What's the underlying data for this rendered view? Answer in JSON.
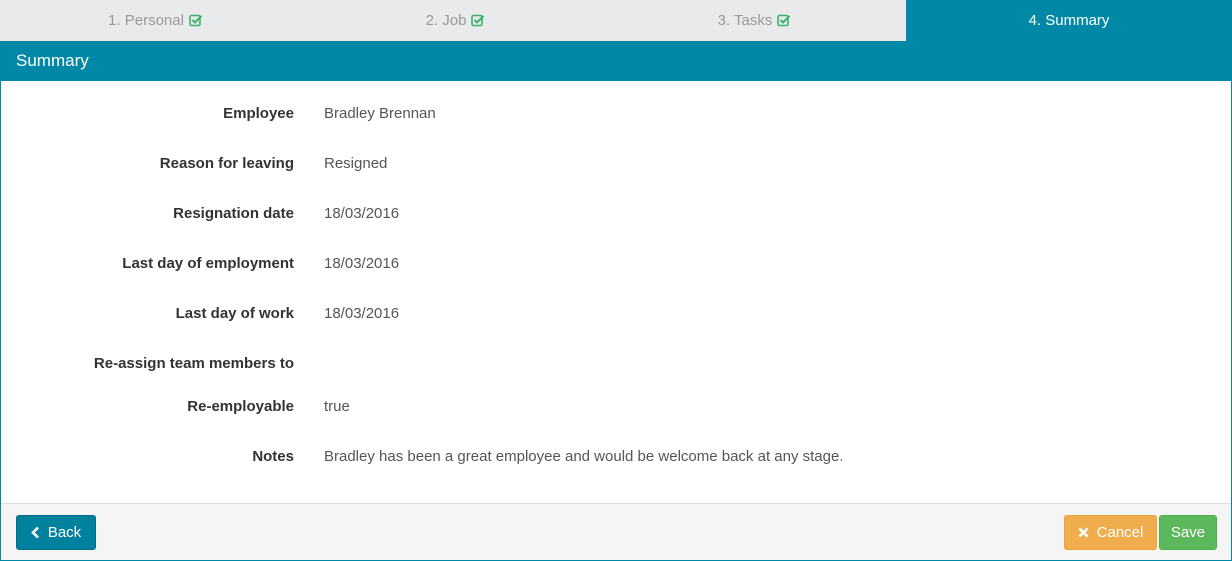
{
  "steps": [
    {
      "label": "1. Personal",
      "done": true
    },
    {
      "label": "2. Job",
      "done": true
    },
    {
      "label": "3. Tasks",
      "done": true
    },
    {
      "label": "4. Summary",
      "done": false
    }
  ],
  "panel": {
    "title": "Summary"
  },
  "summary": [
    {
      "label": "Employee",
      "value": "Bradley Brennan"
    },
    {
      "label": "Reason for leaving",
      "value": "Resigned"
    },
    {
      "label": "Resignation date",
      "value": "18/03/2016"
    },
    {
      "label": "Last day of employment",
      "value": "18/03/2016"
    },
    {
      "label": "Last day of work",
      "value": "18/03/2016"
    },
    {
      "label": "Re-assign team members to",
      "value": ""
    },
    {
      "label": "Re-employable",
      "value": "true"
    },
    {
      "label": "Notes",
      "value": "Bradley has been a great employee and would be welcome back at any stage."
    }
  ],
  "buttons": {
    "back": "Back",
    "cancel": "Cancel",
    "save": "Save"
  },
  "colors": {
    "primary": "#0088a6",
    "success_check": "#3bb36b",
    "warning": "#f0ad4e",
    "success": "#5cb85c"
  },
  "icons": {
    "step_done": "check-square-icon",
    "back": "chevron-left-icon",
    "cancel": "times-icon"
  }
}
